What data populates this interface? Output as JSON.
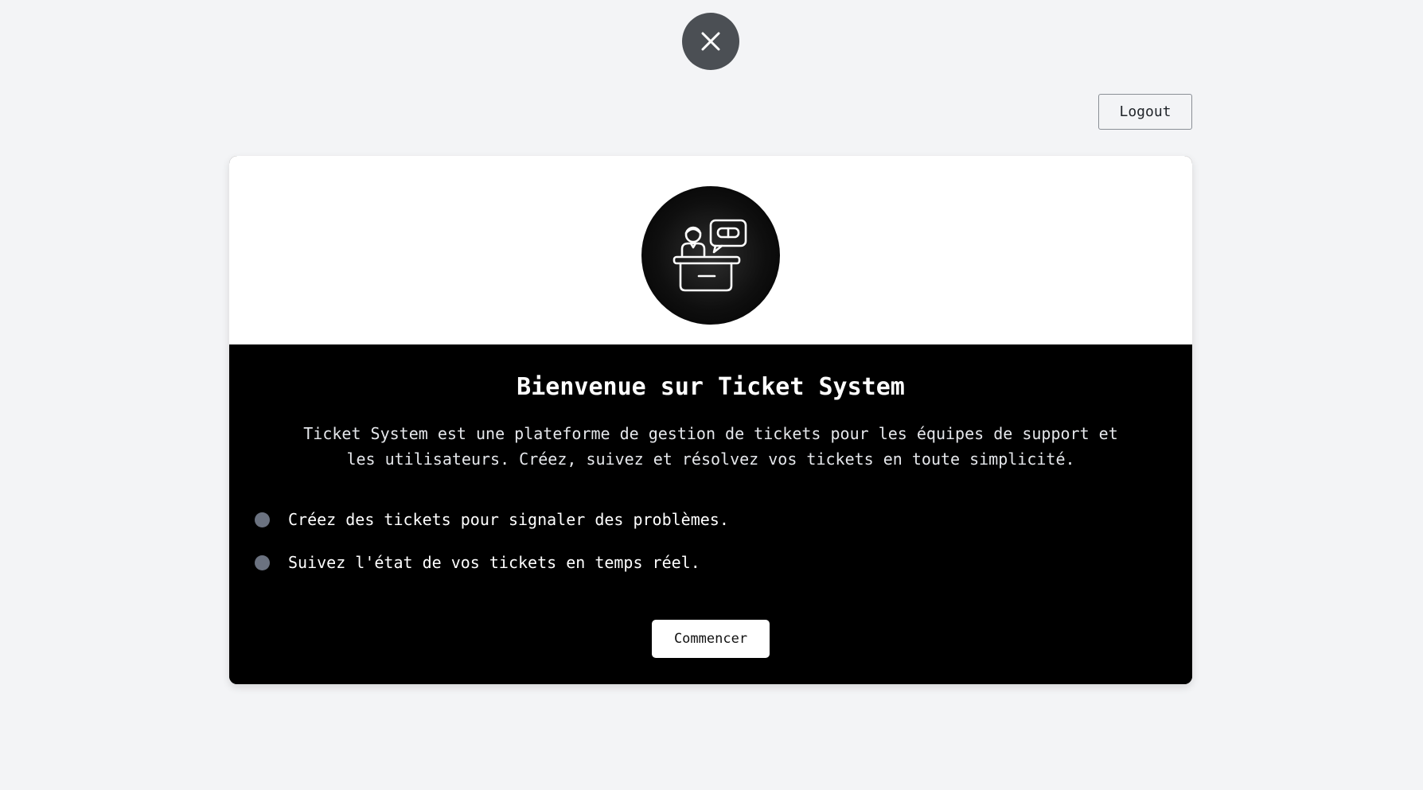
{
  "header": {
    "close_icon": "close-icon",
    "logout_label": "Logout"
  },
  "card": {
    "logo_icon": "support-desk-icon",
    "title": "Bienvenue sur Ticket System",
    "description": "Ticket System est une plateforme de gestion de tickets pour les équipes de support et les utilisateurs. Créez, suivez et résolvez vos tickets en toute simplicité.",
    "features": [
      "Créez des tickets pour signaler des problèmes.",
      "Suivez l'état de vos tickets en temps réel."
    ],
    "start_label": "Commencer"
  },
  "colors": {
    "background": "#f3f4f6",
    "close_button": "#4b4f54",
    "card_dark": "#000000",
    "bullet": "#6b7280"
  }
}
